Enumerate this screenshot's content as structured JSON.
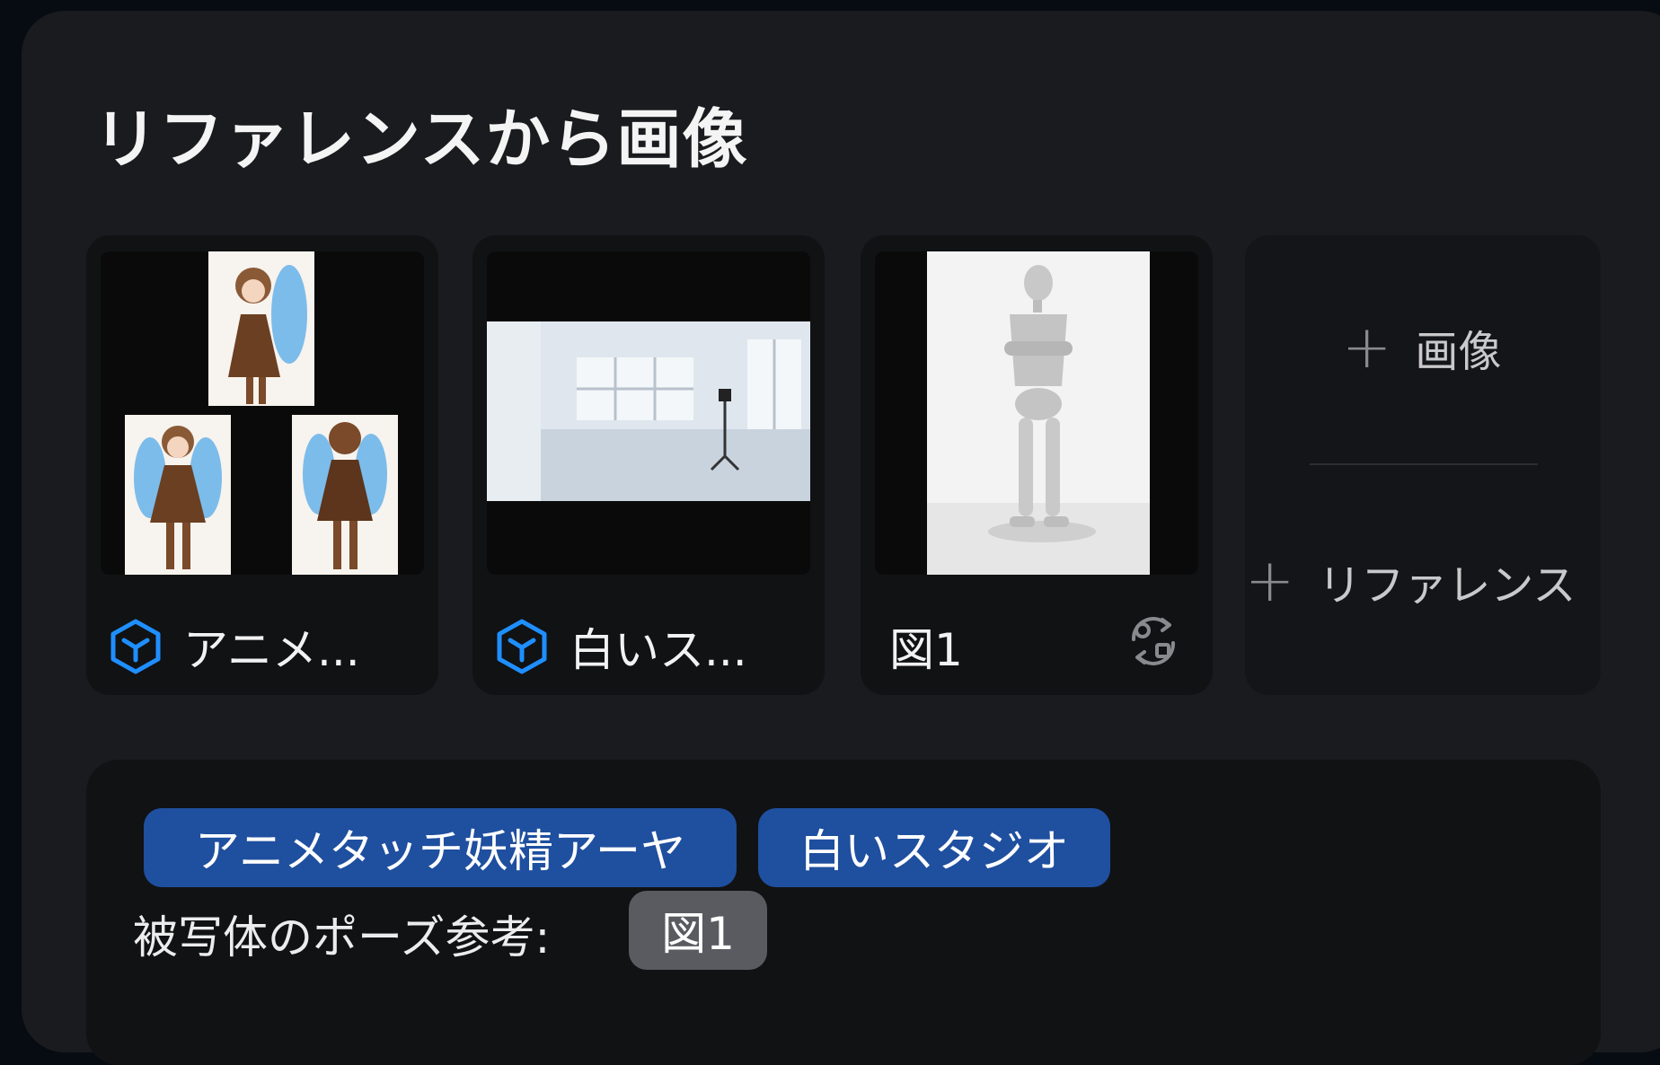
{
  "title": "リファレンスから画像",
  "references": [
    {
      "label": "アニメ...",
      "icon": "cube-icon",
      "icon_color": "#1f8fff"
    },
    {
      "label": "白いス...",
      "icon": "cube-icon",
      "icon_color": "#1f8fff"
    },
    {
      "label": "図1",
      "icon": "swap-icon"
    }
  ],
  "add_card": {
    "image_label": "画像",
    "reference_label": "リファレンス"
  },
  "prompt": {
    "chips": [
      "アニメタッチ妖精アーヤ",
      "白いスタジオ"
    ],
    "text": "被写体のポーズ参考:",
    "pose_chip": "図1"
  },
  "colors": {
    "chip_blue": "#1f4f9f",
    "chip_grey": "#5a5b60",
    "accent_icon": "#1f8fff"
  }
}
